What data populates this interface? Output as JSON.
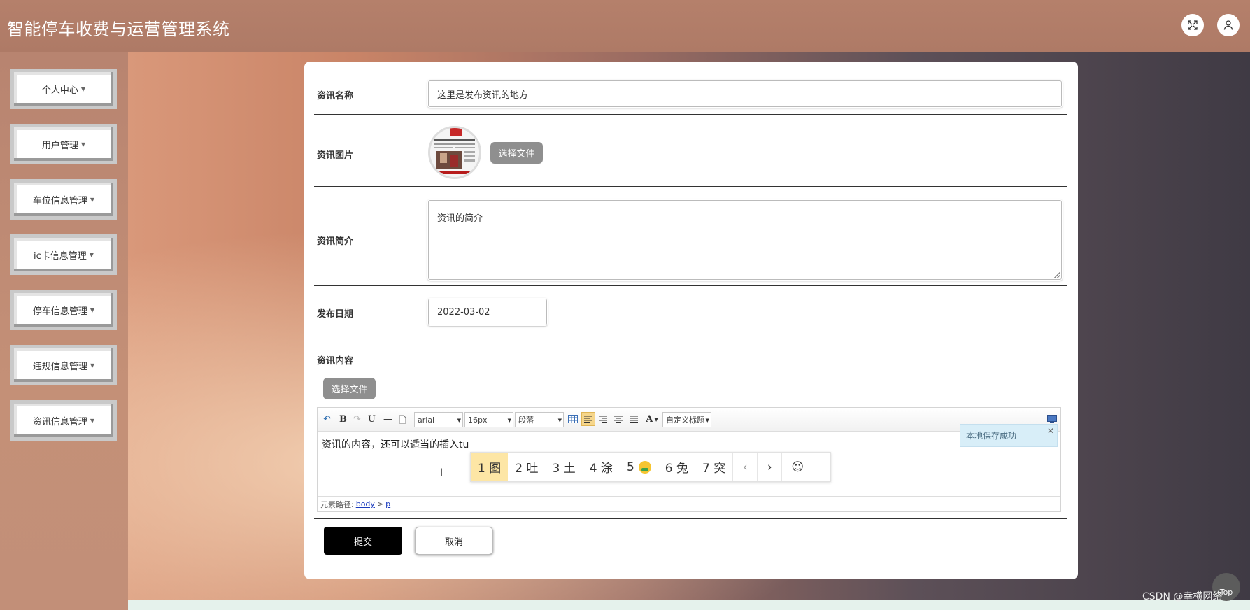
{
  "app": {
    "title": "智能停车收费与运营管理系统"
  },
  "header": {
    "icons": [
      "fullscreen-icon",
      "user-icon"
    ]
  },
  "sidebar": {
    "items": [
      {
        "label": "个人中心"
      },
      {
        "label": "用户管理"
      },
      {
        "label": "车位信息管理"
      },
      {
        "label": "ic卡信息管理"
      },
      {
        "label": "停车信息管理"
      },
      {
        "label": "违规信息管理"
      },
      {
        "label": "资讯信息管理"
      }
    ]
  },
  "form": {
    "name_label": "资讯名称",
    "name_value": "这里是发布资讯的地方",
    "image_label": "资讯图片",
    "image_button": "选择文件",
    "intro_label": "资讯简介",
    "intro_value": "资讯的简介",
    "date_label": "发布日期",
    "date_value": "2022-03-02",
    "content_label": "资讯内容",
    "content_file_button": "选择文件"
  },
  "editor": {
    "font_family": "arial",
    "font_size": "16px",
    "paragraph": "段落",
    "custom_title": "自定义标题",
    "text": "资讯的内容，还可以适当的插入tu",
    "toast": "本地保存成功",
    "path_label": "元素路径:",
    "path_body": "body",
    "path_sep": ">",
    "path_p": "p",
    "ime_candidates": [
      "1 图",
      "2 吐",
      "3 土",
      "4 涂",
      "5",
      "6 兔",
      "7 突"
    ]
  },
  "actions": {
    "submit": "提交",
    "cancel": "取消"
  },
  "misc": {
    "top_label": "Top",
    "watermark": "CSDN @幸横网络"
  }
}
